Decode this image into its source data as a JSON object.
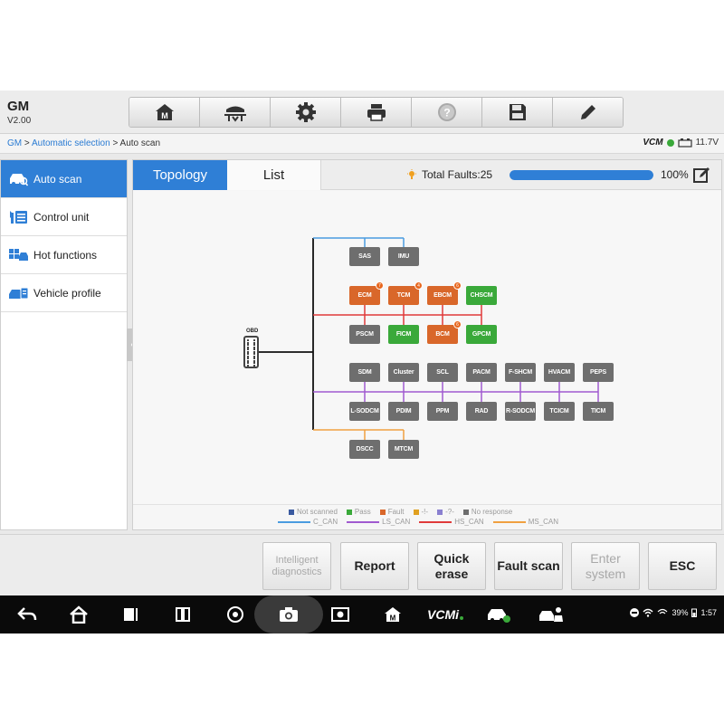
{
  "header": {
    "title": "GM",
    "version": "V2.00",
    "toolbar": [
      "home-icon",
      "vehicle-lift-icon",
      "gear-icon",
      "printer-icon",
      "help-icon",
      "save-icon",
      "pencil-icon"
    ]
  },
  "breadcrumb": {
    "items": [
      "GM",
      "Automatic selection",
      "Auto scan"
    ],
    "separator": ">",
    "vcm": "VCM",
    "battery_voltage": "11.7V"
  },
  "sidebar": {
    "items": [
      {
        "label": "Auto scan",
        "icon": "car-scan-icon",
        "active": true
      },
      {
        "label": "Control unit",
        "icon": "tools-list-icon",
        "active": false
      },
      {
        "label": "Hot functions",
        "icon": "grid-car-icon",
        "active": false
      },
      {
        "label": "Vehicle profile",
        "icon": "car-profile-icon",
        "active": false
      }
    ]
  },
  "tabs": {
    "topology": "Topology",
    "list": "List"
  },
  "faults": {
    "label": "Total Faults:25",
    "progress_percent": 100,
    "progress_text": "100%"
  },
  "diagram": {
    "obd_label": "OBD",
    "modules": [
      {
        "id": "SAS",
        "status": "no-response"
      },
      {
        "id": "IMU",
        "status": "no-response"
      },
      {
        "id": "ECM",
        "status": "fault",
        "badge": "7"
      },
      {
        "id": "TCM",
        "status": "fault",
        "badge": "4"
      },
      {
        "id": "EBCM",
        "status": "fault",
        "badge": "6"
      },
      {
        "id": "CHSCM",
        "status": "pass"
      },
      {
        "id": "PSCM",
        "status": "no-response"
      },
      {
        "id": "FICM",
        "status": "pass"
      },
      {
        "id": "BCM",
        "status": "fault",
        "badge": "6"
      },
      {
        "id": "GPCM",
        "status": "pass"
      },
      {
        "id": "SDM",
        "status": "no-response"
      },
      {
        "id": "Cluster",
        "status": "no-response"
      },
      {
        "id": "SCL",
        "status": "no-response"
      },
      {
        "id": "PACM",
        "status": "no-response"
      },
      {
        "id": "F-SHCM",
        "status": "no-response"
      },
      {
        "id": "HVACM",
        "status": "no-response"
      },
      {
        "id": "PEPS",
        "status": "no-response"
      },
      {
        "id": "L-SODCM",
        "status": "no-response"
      },
      {
        "id": "PDIM",
        "status": "no-response"
      },
      {
        "id": "PPM",
        "status": "no-response"
      },
      {
        "id": "RAD",
        "status": "no-response"
      },
      {
        "id": "R-SODCM",
        "status": "no-response"
      },
      {
        "id": "TCICM",
        "status": "no-response"
      },
      {
        "id": "TICM",
        "status": "no-response"
      },
      {
        "id": "DSCC",
        "status": "no-response"
      },
      {
        "id": "MTCM",
        "status": "no-response"
      }
    ],
    "colors": {
      "pass": "#3aa93a",
      "fault": "#d9672a",
      "no-response": "#6e6e6e",
      "c_can": "#4a9ce0",
      "ls_can": "#a05ad0",
      "hs_can": "#e03a3a",
      "ms_can": "#f0a040"
    }
  },
  "legend": {
    "status": [
      {
        "label": "Not scanned",
        "color": "#3a5aa0"
      },
      {
        "label": "Pass",
        "color": "#3aa93a"
      },
      {
        "label": "Fault",
        "color": "#d9672a"
      },
      {
        "label": "-!-",
        "color": "#e0a020"
      },
      {
        "label": "-?-",
        "color": "#8a80d0"
      },
      {
        "label": "No response",
        "color": "#6e6e6e"
      }
    ],
    "buses": [
      {
        "label": "C_CAN",
        "color": "#4a9ce0"
      },
      {
        "label": "LS_CAN",
        "color": "#a05ad0"
      },
      {
        "label": "HS_CAN",
        "color": "#e03a3a"
      },
      {
        "label": "MS_CAN",
        "color": "#f0a040"
      }
    ]
  },
  "actions": [
    {
      "label": "Intelligent diagnostics",
      "enabled": false
    },
    {
      "label": "Report",
      "enabled": true
    },
    {
      "label": "Quick erase",
      "enabled": true
    },
    {
      "label": "Fault scan",
      "enabled": true
    },
    {
      "label": "Enter system",
      "enabled": false
    },
    {
      "label": "ESC",
      "enabled": true
    }
  ],
  "navbar": {
    "icons": [
      "back-icon",
      "home-icon",
      "recents-icon",
      "split-screen-icon",
      "chrome-icon",
      "camera-icon",
      "screen-record-icon",
      "autel-home-icon",
      "vcmi-icon",
      "car-connected-icon",
      "car-service-icon"
    ],
    "vcmi_label": "VCMi",
    "battery": "39%",
    "time": "1:57"
  }
}
